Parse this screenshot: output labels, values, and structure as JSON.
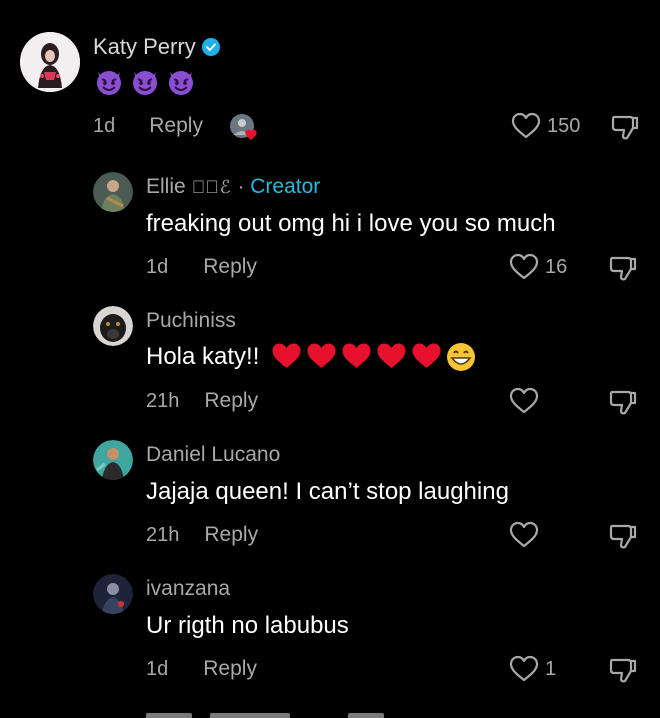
{
  "comments": [
    {
      "username": "Katy Perry",
      "text_emojis": [
        "😈",
        "😈",
        "😈"
      ],
      "time": "1d",
      "reply": "Reply",
      "likes": "150"
    },
    {
      "username": "Ellie",
      "username_deco": "ℱ⃝ℰ",
      "separator": "·",
      "badge": "Creator",
      "text": "freaking out omg hi i love you so much",
      "time": "1d",
      "reply": "Reply",
      "likes": "16"
    },
    {
      "username": "Puchiniss",
      "text": "Hola katy!!",
      "time": "21h",
      "reply": "Reply",
      "likes": ""
    },
    {
      "username": "Daniel Lucano",
      "text": "Jajaja queen! I can’t stop laughing",
      "time": "21h",
      "reply": "Reply",
      "likes": ""
    },
    {
      "username": "ivanzana",
      "text": "Ur rigth no labubus",
      "time": "1d",
      "reply": "Reply",
      "likes": "1"
    }
  ],
  "colors": {
    "background": "#000000",
    "muted_text": "#a8a8a8",
    "creator_badge": "#29b8e0",
    "verified_badge": "#20b0e8",
    "heart": "#e8112d"
  },
  "icons": [
    "verified-badge-icon",
    "heart-outline-icon",
    "thumbs-down-icon",
    "red-heart-emoji",
    "grinning-emoji",
    "devil-emoji"
  ]
}
